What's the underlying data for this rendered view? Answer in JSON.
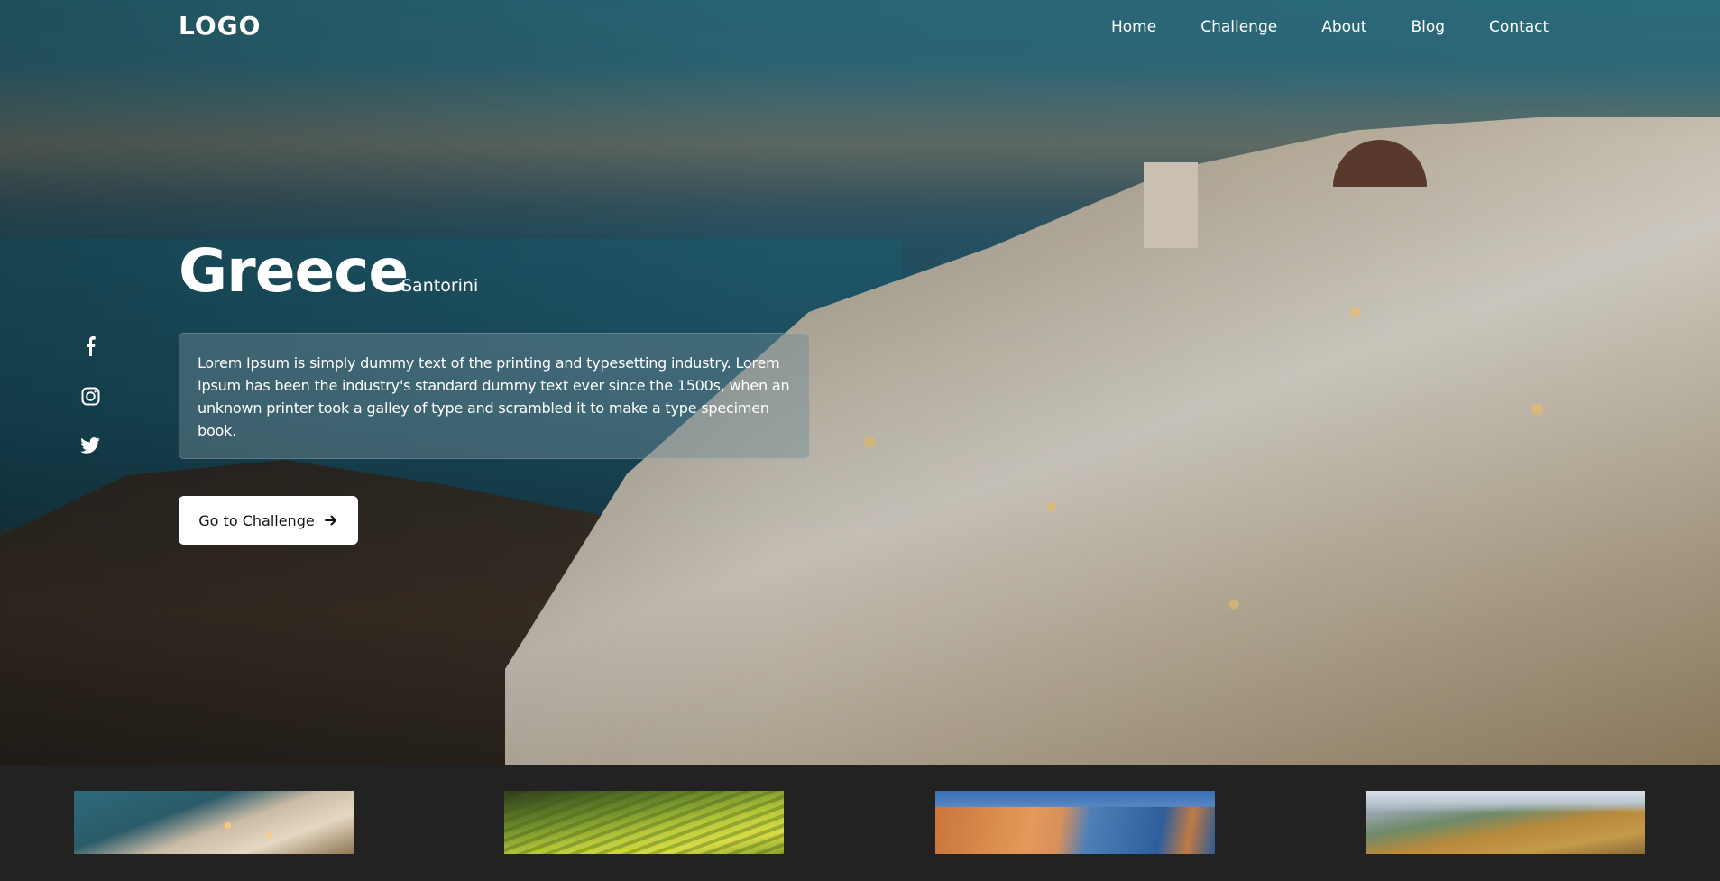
{
  "header": {
    "logo": "LOGO",
    "nav": [
      "Home",
      "Challenge",
      "About",
      "Blog",
      "Contact"
    ]
  },
  "social": [
    "facebook-icon",
    "instagram-icon",
    "twitter-icon"
  ],
  "hero": {
    "title": "Greece",
    "subtitle": "Santorini",
    "description": "Lorem Ipsum is simply dummy text of the printing and typesetting industry. Lorem Ipsum has been the industry's standard dummy text ever since the 1500s, when an unknown printer took a galley of type and scrambled it to make a type specimen book.",
    "cta_label": "Go to Challenge"
  },
  "thumbnails": [
    "thumbnail-santorini",
    "thumbnail-rice-terraces",
    "thumbnail-coastal-cliffs",
    "thumbnail-mountain-lake"
  ],
  "colors": {
    "background_bottom": "#222222",
    "cta_bg": "#ffffff",
    "text_light": "#ffffff"
  }
}
